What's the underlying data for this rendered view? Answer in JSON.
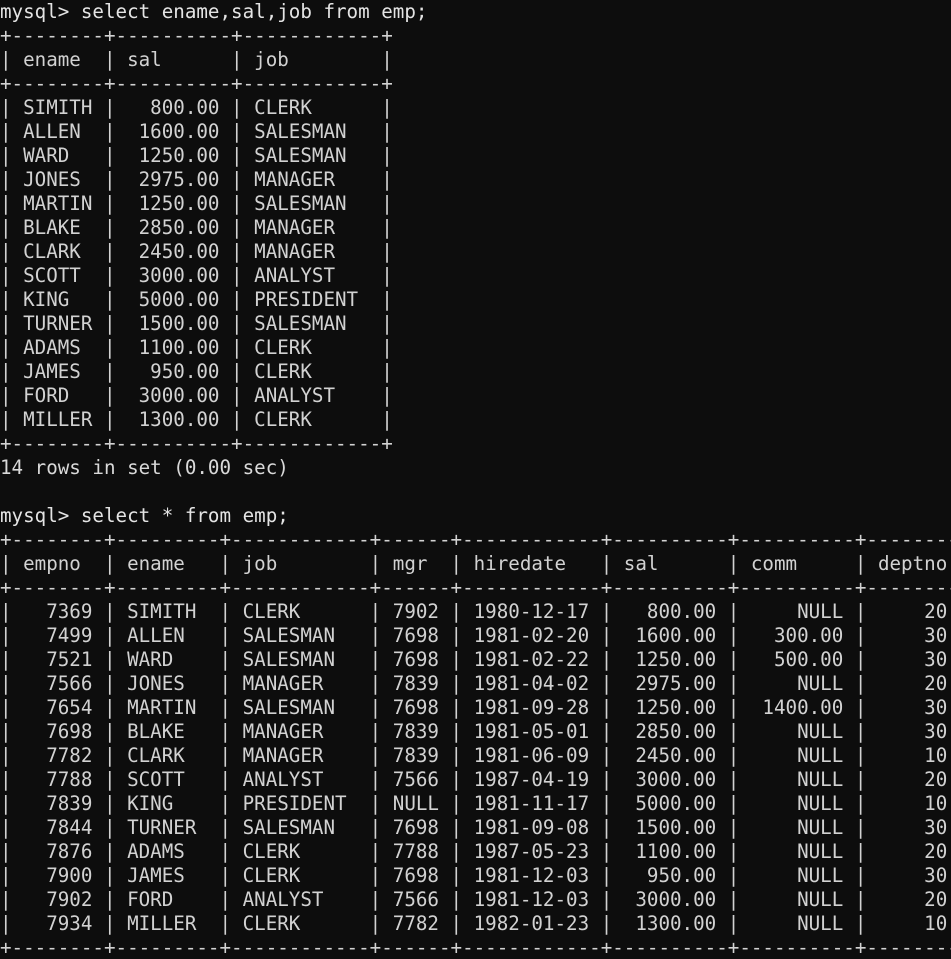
{
  "terminal": {
    "background_color": "#0d0d0d",
    "text_color": "#d9d9d9",
    "prompt_label": "mysql>"
  },
  "session": {
    "blocks": [
      {
        "kind": "command",
        "name": "first-query-command",
        "text": "mysql> select ename,sal,job from emp;"
      },
      {
        "kind": "table",
        "name": "first-query-result-table"
      },
      {
        "kind": "status",
        "name": "first-query-status",
        "text": "14 rows in set (0.00 sec)"
      },
      {
        "kind": "blank",
        "name": "blank-line-1",
        "text": ""
      },
      {
        "kind": "command",
        "name": "second-query-command",
        "text": "mysql> select * from emp;"
      },
      {
        "kind": "table",
        "name": "second-query-result-table"
      }
    ]
  },
  "queries": {
    "first": {
      "prompt": "mysql>",
      "sql": "select ename,sal,job from emp;",
      "full_line": "mysql> select ename,sal,job from emp;",
      "status": "14 rows in set (0.00 sec)",
      "row_count": 14,
      "elapsed": "0.00 sec"
    },
    "second": {
      "prompt": "mysql>",
      "sql": "select * from emp;",
      "full_line": "mysql> select * from emp;"
    }
  },
  "table_one": {
    "name": "ename-sal-job-table",
    "columns": [
      {
        "label": "ename",
        "width": 8,
        "align": "left"
      },
      {
        "label": "sal",
        "width": 10,
        "align": "right"
      },
      {
        "label": "job",
        "width": 12,
        "align": "left"
      }
    ],
    "rows": [
      [
        "SIMITH",
        "800.00",
        "CLERK"
      ],
      [
        "ALLEN",
        "1600.00",
        "SALESMAN"
      ],
      [
        "WARD",
        "1250.00",
        "SALESMAN"
      ],
      [
        "JONES",
        "2975.00",
        "MANAGER"
      ],
      [
        "MARTIN",
        "1250.00",
        "SALESMAN"
      ],
      [
        "BLAKE",
        "2850.00",
        "MANAGER"
      ],
      [
        "CLARK",
        "2450.00",
        "MANAGER"
      ],
      [
        "SCOTT",
        "3000.00",
        "ANALYST"
      ],
      [
        "KING",
        "5000.00",
        "PRESIDENT"
      ],
      [
        "TURNER",
        "1500.00",
        "SALESMAN"
      ],
      [
        "ADAMS",
        "1100.00",
        "CLERK"
      ],
      [
        "JAMES",
        "950.00",
        "CLERK"
      ],
      [
        "FORD",
        "3000.00",
        "ANALYST"
      ],
      [
        "MILLER",
        "1300.00",
        "CLERK"
      ]
    ]
  },
  "table_two": {
    "name": "emp-full-table",
    "columns": [
      {
        "label": "empno",
        "width": 8,
        "align": "right"
      },
      {
        "label": "ename",
        "width": 9,
        "align": "left"
      },
      {
        "label": "job",
        "width": 12,
        "align": "left"
      },
      {
        "label": "mgr",
        "width": 6,
        "align": "right"
      },
      {
        "label": "hiredate",
        "width": 12,
        "align": "left"
      },
      {
        "label": "sal",
        "width": 10,
        "align": "right"
      },
      {
        "label": "comm",
        "width": 10,
        "align": "right"
      },
      {
        "label": "deptno",
        "width": 8,
        "align": "right"
      }
    ],
    "rows": [
      [
        "7369",
        "SIMITH",
        "CLERK",
        "7902",
        "1980-12-17",
        "800.00",
        "NULL",
        "20"
      ],
      [
        "7499",
        "ALLEN",
        "SALESMAN",
        "7698",
        "1981-02-20",
        "1600.00",
        "300.00",
        "30"
      ],
      [
        "7521",
        "WARD",
        "SALESMAN",
        "7698",
        "1981-02-22",
        "1250.00",
        "500.00",
        "30"
      ],
      [
        "7566",
        "JONES",
        "MANAGER",
        "7839",
        "1981-04-02",
        "2975.00",
        "NULL",
        "20"
      ],
      [
        "7654",
        "MARTIN",
        "SALESMAN",
        "7698",
        "1981-09-28",
        "1250.00",
        "1400.00",
        "30"
      ],
      [
        "7698",
        "BLAKE",
        "MANAGER",
        "7839",
        "1981-05-01",
        "2850.00",
        "NULL",
        "30"
      ],
      [
        "7782",
        "CLARK",
        "MANAGER",
        "7839",
        "1981-06-09",
        "2450.00",
        "NULL",
        "10"
      ],
      [
        "7788",
        "SCOTT",
        "ANALYST",
        "7566",
        "1987-04-19",
        "3000.00",
        "NULL",
        "20"
      ],
      [
        "7839",
        "KING",
        "PRESIDENT",
        "NULL",
        "1981-11-17",
        "5000.00",
        "NULL",
        "10"
      ],
      [
        "7844",
        "TURNER",
        "SALESMAN",
        "7698",
        "1981-09-08",
        "1500.00",
        "NULL",
        "30"
      ],
      [
        "7876",
        "ADAMS",
        "CLERK",
        "7788",
        "1987-05-23",
        "1100.00",
        "NULL",
        "20"
      ],
      [
        "7900",
        "JAMES",
        "CLERK",
        "7698",
        "1981-12-03",
        "950.00",
        "NULL",
        "30"
      ],
      [
        "7902",
        "FORD",
        "ANALYST",
        "7566",
        "1981-12-03",
        "3000.00",
        "NULL",
        "20"
      ],
      [
        "7934",
        "MILLER",
        "CLERK",
        "7782",
        "1982-01-23",
        "1300.00",
        "NULL",
        "10"
      ]
    ]
  }
}
